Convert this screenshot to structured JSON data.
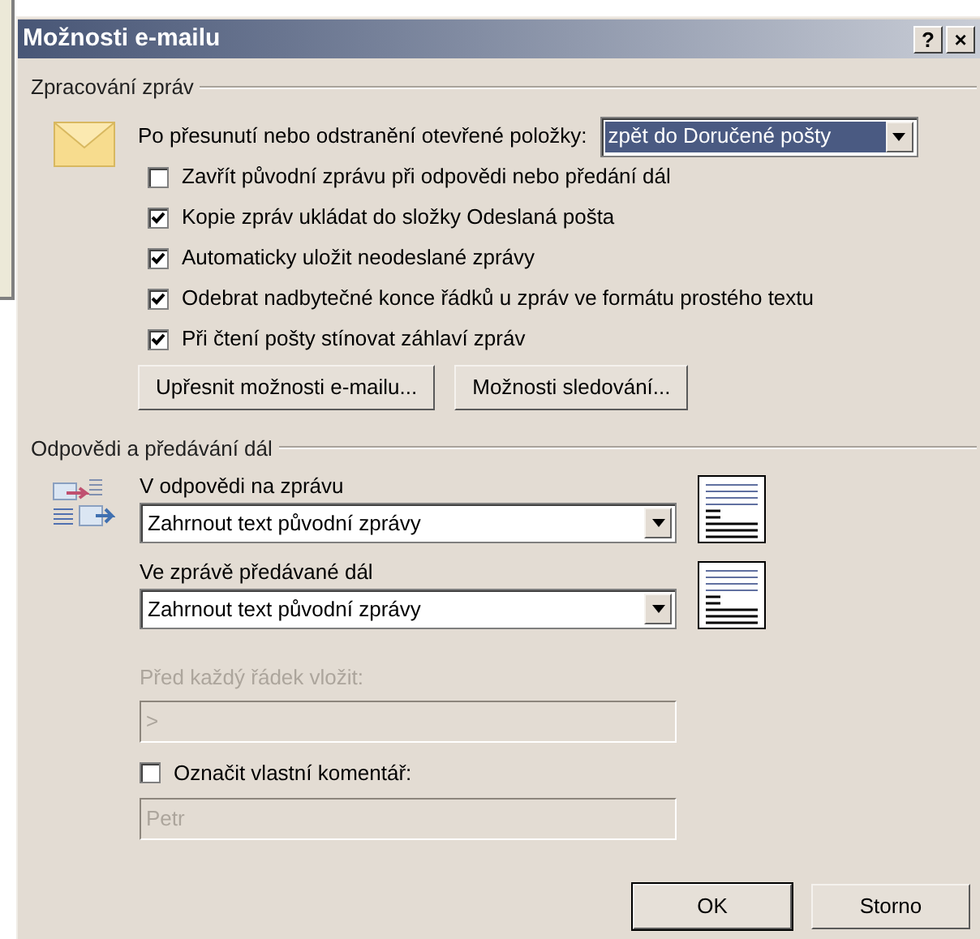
{
  "window": {
    "title": "Možnosti e-mailu",
    "title_buttons": [
      "?",
      "×"
    ]
  },
  "message_handling": {
    "label": "Zpracování zpráv",
    "after_move": {
      "label": "Po přesunutí nebo odstranění otevřené položky:",
      "value": "zpět do Doručené pošty",
      "selected": true
    },
    "options": [
      {
        "label": "Zavřít původní zprávu při odpovědi nebo předání dál",
        "checked": false
      },
      {
        "label": "Kopie zpráv ukládat do složky Odeslaná pošta",
        "checked": true
      },
      {
        "label": "Automaticky uložit neodeslané zprávy",
        "checked": true
      },
      {
        "label": "Odebrat nadbytečné konce řádků u zpráv ve formátu prostého textu",
        "checked": true
      },
      {
        "label": "Při čtení pošty stínovat záhlaví zpráv",
        "checked": true
      }
    ],
    "buttons": [
      "Upřesnit možnosti e-mailu...",
      "Možnosti sledování..."
    ]
  },
  "replies": {
    "label": "Odpovědi a předávání dál",
    "combos": [
      {
        "label": "V odpovědi na zprávu",
        "value": "Zahrnout text původní zprávy"
      },
      {
        "label": "Ve zprávě předávané dál",
        "value": "Zahrnout text původní zprávy"
      }
    ],
    "prefix": {
      "label": "Před každý řádek vložit:",
      "value": ">",
      "disabled": true
    },
    "mark_comments": {
      "label": "Označit vlastní komentář:",
      "checked": false,
      "value": "Petr",
      "disabled": true
    }
  },
  "buttons": [
    {
      "label": "OK",
      "default": true
    },
    {
      "label": "Storno",
      "default": false
    }
  ]
}
